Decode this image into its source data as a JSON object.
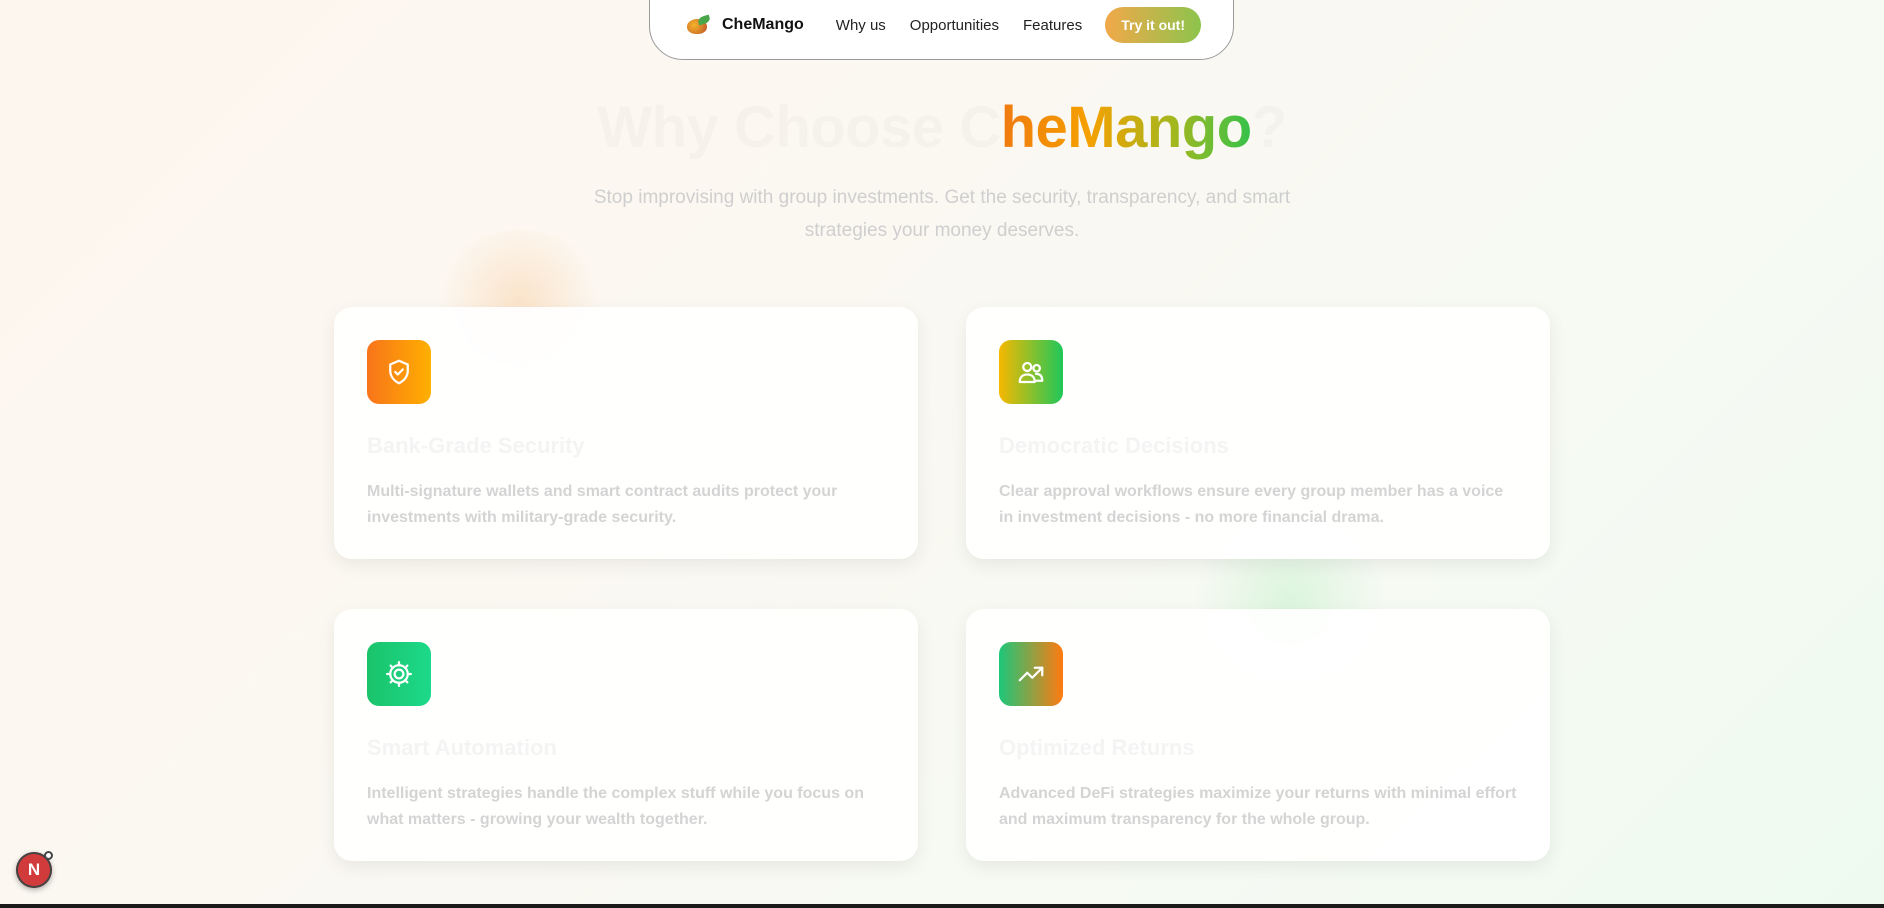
{
  "nav": {
    "brand": "CheMango",
    "links": [
      "Why us",
      "Opportunities",
      "Features"
    ],
    "cta": "Try it out!"
  },
  "hero": {
    "headline_lead": "Why Choose C",
    "headline_brand": "heMango",
    "headline_tail": "?",
    "subtitle": "Stop improvising with group investments. Get the security, transparency, and smart strategies your money deserves."
  },
  "features": [
    {
      "icon": "shield-check-icon",
      "title": "Bank-Grade Security",
      "description": "Multi-signature wallets and smart contract audits protect your investments with military-grade security."
    },
    {
      "icon": "users-icon",
      "title": "Democratic Decisions",
      "description": "Clear approval workflows ensure every group member has a voice in investment decisions - no more financial drama."
    },
    {
      "icon": "gear-icon",
      "title": "Smart Automation",
      "description": "Intelligent strategies handle the complex stuff while you focus on what matters - growing your wealth together."
    },
    {
      "icon": "trending-up-icon",
      "title": "Optimized Returns",
      "description": "Advanced DeFi strategies maximize your returns with minimal effort and maximum transparency for the whole group."
    }
  ],
  "badge": {
    "label": "N"
  },
  "colors": {
    "accent_orange": "#f07a10",
    "accent_green": "#34c24a",
    "card_bg": "#ffffff"
  }
}
